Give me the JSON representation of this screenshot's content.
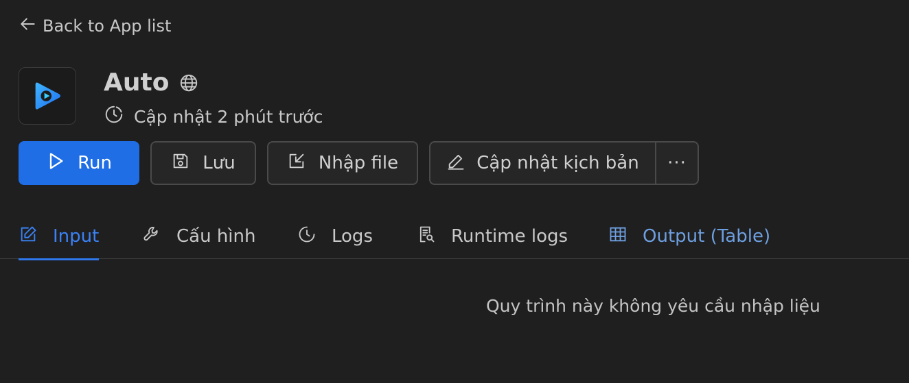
{
  "nav": {
    "back_label": "Back to App list"
  },
  "app": {
    "name": "Auto",
    "updated": "Cập nhật 2 phút trước"
  },
  "toolbar": {
    "run_label": "Run",
    "save_label": "Lưu",
    "import_label": "Nhập file",
    "update_script_label": "Cập nhật kịch bản",
    "more_label": "···"
  },
  "tabs": [
    {
      "label": "Input",
      "icon": "edit-icon",
      "active": true
    },
    {
      "label": "Cấu hình",
      "icon": "wrench-icon"
    },
    {
      "label": "Logs",
      "icon": "history-icon"
    },
    {
      "label": "Runtime logs",
      "icon": "log-search-icon"
    },
    {
      "label": "Output (Table)",
      "icon": "table-icon"
    }
  ],
  "content": {
    "empty_message": "Quy trình này không yêu cầu nhập liệu"
  },
  "colors": {
    "background": "#1f1f1f",
    "accent": "#1f6ee5",
    "tab_active": "#3b82f6"
  }
}
